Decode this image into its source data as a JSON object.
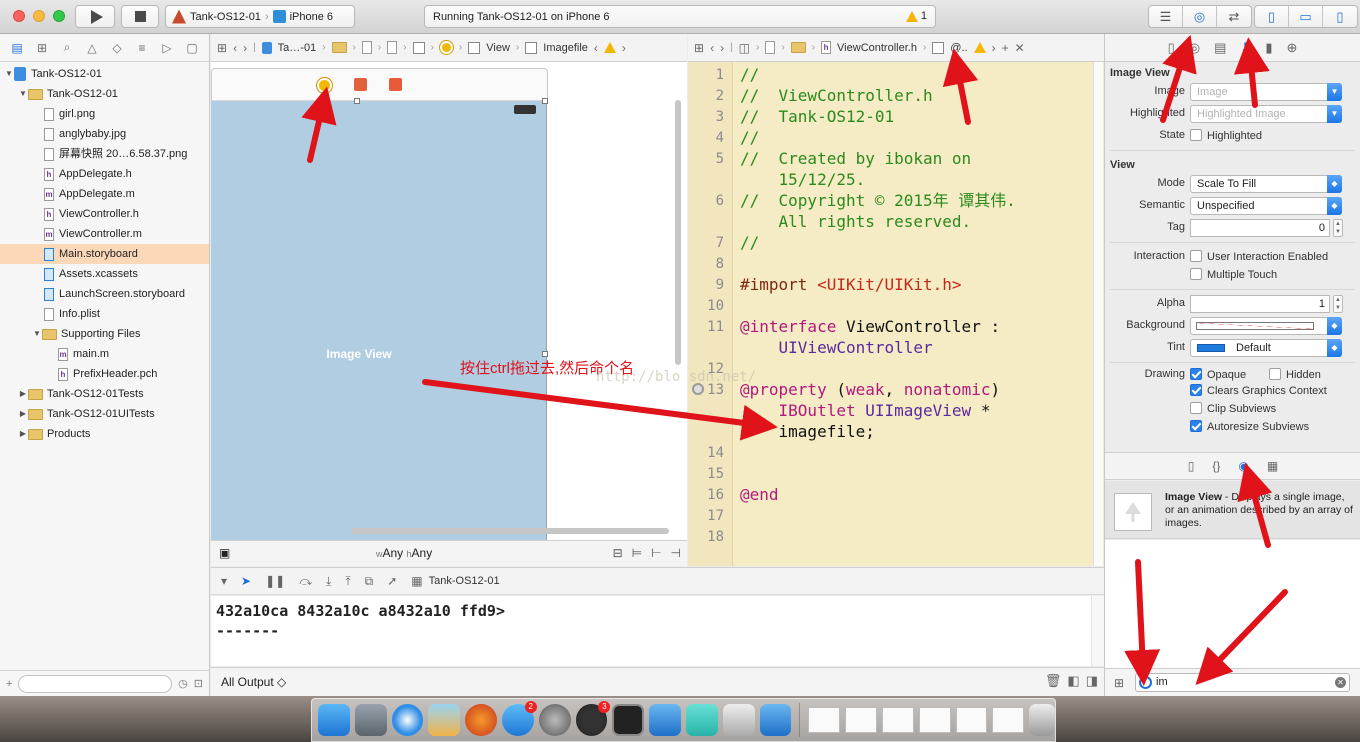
{
  "toolbar": {
    "scheme_target": "Tank-OS12-01",
    "scheme_device": "iPhone 6",
    "status_text": "Running Tank-OS12-01 on iPhone 6",
    "warning_count": "1"
  },
  "navigator": {
    "items": [
      {
        "label": "Tank-OS12-01",
        "depth": 0,
        "kind": "project",
        "disclosure": "▼"
      },
      {
        "label": "Tank-OS12-01",
        "depth": 1,
        "kind": "folder",
        "disclosure": "▼"
      },
      {
        "label": "girl.png",
        "depth": 2,
        "kind": "image",
        "disclosure": ""
      },
      {
        "label": "anglybaby.jpg",
        "depth": 2,
        "kind": "image",
        "disclosure": ""
      },
      {
        "label": "屏幕快照 20…6.58.37.png",
        "depth": 2,
        "kind": "image",
        "disclosure": ""
      },
      {
        "label": "AppDelegate.h",
        "depth": 2,
        "kind": "h",
        "disclosure": ""
      },
      {
        "label": "AppDelegate.m",
        "depth": 2,
        "kind": "m",
        "disclosure": ""
      },
      {
        "label": "ViewController.h",
        "depth": 2,
        "kind": "h",
        "disclosure": ""
      },
      {
        "label": "ViewController.m",
        "depth": 2,
        "kind": "m",
        "disclosure": ""
      },
      {
        "label": "Main.storyboard",
        "depth": 2,
        "kind": "storyboard",
        "disclosure": "",
        "selected": true
      },
      {
        "label": "Assets.xcassets",
        "depth": 2,
        "kind": "assets",
        "disclosure": ""
      },
      {
        "label": "LaunchScreen.storyboard",
        "depth": 2,
        "kind": "storyboard",
        "disclosure": ""
      },
      {
        "label": "Info.plist",
        "depth": 2,
        "kind": "plist",
        "disclosure": ""
      },
      {
        "label": "Supporting Files",
        "depth": 2,
        "kind": "folder",
        "disclosure": "▼"
      },
      {
        "label": "main.m",
        "depth": 3,
        "kind": "m",
        "disclosure": ""
      },
      {
        "label": "PrefixHeader.pch",
        "depth": 3,
        "kind": "h",
        "disclosure": ""
      },
      {
        "label": "Tank-OS12-01Tests",
        "depth": 1,
        "kind": "folder",
        "disclosure": "▶"
      },
      {
        "label": "Tank-OS12-01UITests",
        "depth": 1,
        "kind": "folder",
        "disclosure": "▶"
      },
      {
        "label": "Products",
        "depth": 1,
        "kind": "folder",
        "disclosure": "▶"
      }
    ]
  },
  "storyboard_jumpbar": {
    "crumb1": "Ta…-01",
    "crumb_view": "View",
    "crumb_last": "Imagefile"
  },
  "code_jumpbar": {
    "file": "ViewController.h",
    "symbol": "@.."
  },
  "canvas": {
    "image_view_label": "Image View",
    "size_w_prefix": "w",
    "size_w": "Any",
    "size_h_prefix": "h",
    "size_h": "Any"
  },
  "code_lines": [
    {
      "n": "1",
      "text": "//",
      "cls": "c-cmt"
    },
    {
      "n": "2",
      "text": "//  ViewController.h",
      "cls": "c-cmt"
    },
    {
      "n": "3",
      "text": "//  Tank-OS12-01",
      "cls": "c-cmt"
    },
    {
      "n": "4",
      "text": "//",
      "cls": "c-cmt"
    },
    {
      "n": "5",
      "text": "//  Created by ibokan on",
      "cls": "c-cmt"
    },
    {
      "n": "",
      "text": "    15/12/25.",
      "cls": "c-cmt"
    },
    {
      "n": "6",
      "text": "//  Copyright © 2015年 谭其伟.",
      "cls": "c-cmt"
    },
    {
      "n": "",
      "text": "    All rights reserved.",
      "cls": "c-cmt"
    },
    {
      "n": "7",
      "text": "//",
      "cls": "c-cmt"
    },
    {
      "n": "8",
      "text": "",
      "cls": "c-plain"
    },
    {
      "n": "9",
      "text": "",
      "cls": "c-plain",
      "parts": [
        {
          "t": "#import ",
          "c": "c-pre"
        },
        {
          "t": "<UIKit/UIKit.h>",
          "c": "c-str"
        }
      ]
    },
    {
      "n": "10",
      "text": "",
      "cls": "c-plain"
    },
    {
      "n": "11",
      "text": "",
      "cls": "c-plain",
      "parts": [
        {
          "t": "@interface",
          "c": "c-kw"
        },
        {
          "t": " ViewController :",
          "c": "c-plain"
        }
      ]
    },
    {
      "n": "",
      "text": "    UIViewController",
      "cls": "c-type"
    },
    {
      "n": "12",
      "text": "",
      "cls": "c-plain"
    },
    {
      "n": "13",
      "text": "",
      "cls": "c-plain",
      "parts": [
        {
          "t": "@property",
          "c": "c-kw"
        },
        {
          "t": " (",
          "c": "c-plain"
        },
        {
          "t": "weak",
          "c": "c-kw"
        },
        {
          "t": ", ",
          "c": "c-plain"
        },
        {
          "t": "nonatomic",
          "c": "c-kw"
        },
        {
          "t": ")",
          "c": "c-plain"
        }
      ]
    },
    {
      "n": "",
      "text": "",
      "cls": "c-plain",
      "parts": [
        {
          "t": "    IBOutlet",
          "c": "c-kw"
        },
        {
          "t": " UIImageView",
          "c": "c-type"
        },
        {
          "t": " *",
          "c": "c-plain"
        }
      ]
    },
    {
      "n": "",
      "text": "    imagefile;",
      "cls": "c-plain"
    },
    {
      "n": "14",
      "text": "",
      "cls": "c-plain"
    },
    {
      "n": "15",
      "text": "",
      "cls": "c-plain"
    },
    {
      "n": "16",
      "text": "@end",
      "cls": "c-kw"
    },
    {
      "n": "17",
      "text": "",
      "cls": "c-plain"
    },
    {
      "n": "18",
      "text": "",
      "cls": "c-plain"
    }
  ],
  "watermark": "http://blo     sdn.net/",
  "annotation": "按住ctrl拖过去,然后命个名",
  "debug": {
    "target": "Tank-OS12-01",
    "console_lines": [
      "432a10ca 8432a10c a8432a10 ffd9>",
      "-------"
    ],
    "output_selector": "All Output ◇"
  },
  "inspector": {
    "image_view_title": "Image View",
    "image_label": "Image",
    "image_placeholder": "Image",
    "highlighted_label": "Highlighted",
    "highlighted_placeholder": "Highlighted Image",
    "state_label": "State",
    "state_option": "Highlighted",
    "view_title": "View",
    "mode_label": "Mode",
    "mode_value": "Scale To Fill",
    "semantic_label": "Semantic",
    "semantic_value": "Unspecified",
    "tag_label": "Tag",
    "tag_value": "0",
    "interaction_label": "Interaction",
    "user_interaction": "User Interaction Enabled",
    "multiple_touch": "Multiple Touch",
    "alpha_label": "Alpha",
    "alpha_value": "1",
    "background_label": "Background",
    "tint_label": "Tint",
    "tint_value": "Default",
    "drawing_label": "Drawing",
    "opaque": "Opaque",
    "hidden": "Hidden",
    "clears_graphics": "Clears Graphics Context",
    "clip_subviews": "Clip Subviews",
    "autoresize": "Autoresize Subviews",
    "colors": {
      "tint": "#1d7be0",
      "accent": "#1e6fd9"
    }
  },
  "library": {
    "item_name": "Image View",
    "item_desc": " - Displays a single image, or an animation described by an array of images.",
    "search_value": "im"
  }
}
